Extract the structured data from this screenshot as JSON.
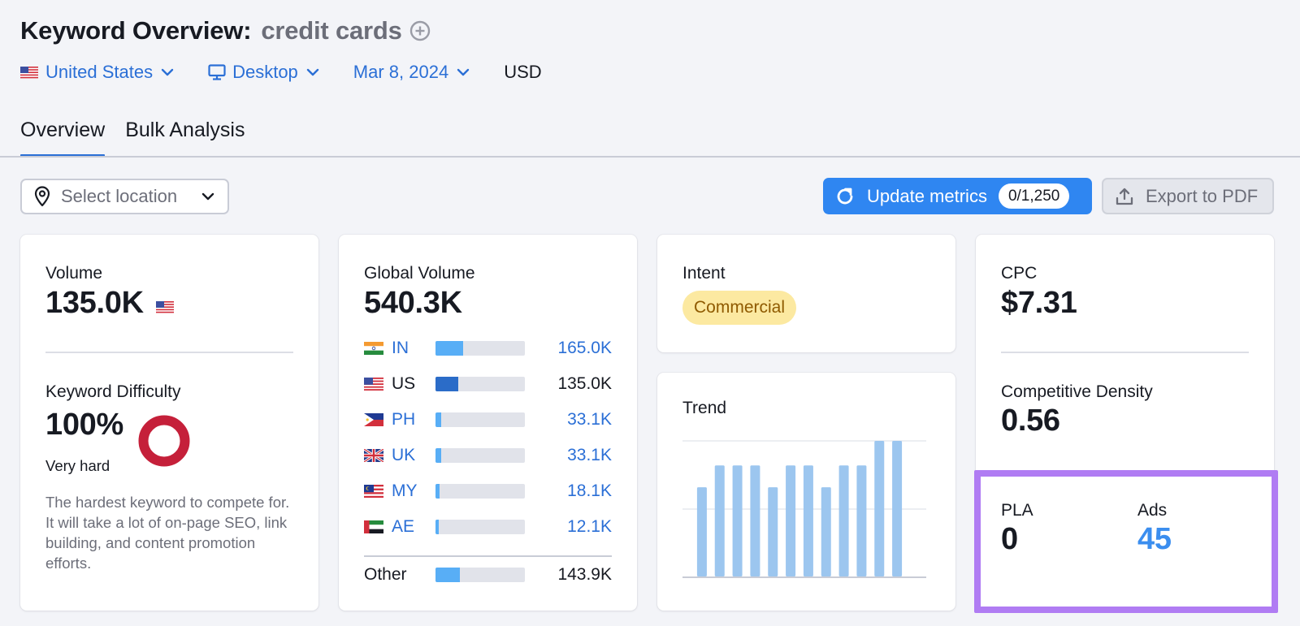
{
  "header": {
    "title": "Keyword Overview:",
    "keyword": "credit cards",
    "filters": {
      "country": "United States",
      "device": "Desktop",
      "date": "Mar 8, 2024",
      "currency": "USD"
    }
  },
  "tabs": [
    {
      "label": "Overview",
      "active": true
    },
    {
      "label": "Bulk Analysis",
      "active": false
    }
  ],
  "toolbar": {
    "location_placeholder": "Select location",
    "update_label": "Update metrics",
    "update_counter": "0/1,250",
    "export_label": "Export to PDF"
  },
  "volume_card": {
    "volume_label": "Volume",
    "volume_value": "135.0K",
    "kd_label": "Keyword Difficulty",
    "kd_value": "100%",
    "kd_rating": "Very hard",
    "kd_percent": 100,
    "kd_color": "#c5203a",
    "kd_description": "The hardest keyword to compete for. It will take a lot of on-page SEO, link building, and content promotion efforts."
  },
  "global_card": {
    "label": "Global Volume",
    "value": "540.3K",
    "rows": [
      {
        "code": "IN",
        "value": "165.0K",
        "share": 0.31,
        "flag": "india-flag"
      },
      {
        "code": "US",
        "value": "135.0K",
        "share": 0.25,
        "flag": "usa-flag"
      },
      {
        "code": "PH",
        "value": "33.1K",
        "share": 0.06,
        "flag": "philippines-flag"
      },
      {
        "code": "UK",
        "value": "33.1K",
        "share": 0.06,
        "flag": "uk-flag"
      },
      {
        "code": "MY",
        "value": "18.1K",
        "share": 0.045,
        "flag": "malaysia-flag"
      },
      {
        "code": "AE",
        "value": "12.1K",
        "share": 0.04,
        "flag": "uae-flag"
      }
    ],
    "other": {
      "label": "Other",
      "value": "143.9K",
      "share": 0.27
    }
  },
  "intent_card": {
    "label": "Intent",
    "badge": "Commercial"
  },
  "trend_card": {
    "label": "Trend",
    "chart_data": {
      "type": "bar",
      "values": [
        0.66,
        0.82,
        0.82,
        0.82,
        0.66,
        0.82,
        0.82,
        0.66,
        0.82,
        0.82,
        1.0,
        1.0
      ],
      "ylim": [
        0,
        1
      ],
      "grid": true,
      "color": "#9cc6ef"
    }
  },
  "cpc_card": {
    "cpc_label": "CPC",
    "cpc_value": "$7.31",
    "cd_label": "Competitive Density",
    "cd_value": "0.56",
    "pla_label": "PLA",
    "pla_value": "0",
    "ads_label": "Ads",
    "ads_value": "45"
  },
  "colors": {
    "accent": "#2b6fd6",
    "button": "#2f86f1",
    "highlight": "#b07cf3"
  }
}
